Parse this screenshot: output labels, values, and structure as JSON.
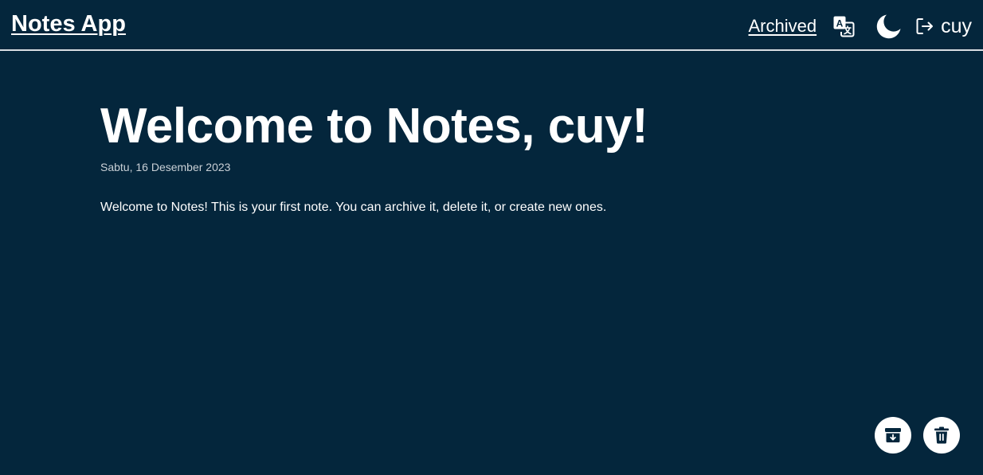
{
  "header": {
    "brand": "Notes App",
    "archived_link": "Archived",
    "user_name": "cuy",
    "icons": {
      "translate": "translate-icon",
      "theme": "moon-icon",
      "logout": "logout-icon"
    }
  },
  "note": {
    "title": "Welcome to Notes, cuy!",
    "date": "Sabtu, 16 Desember 2023",
    "body": "Welcome to Notes! This is your first note. You can archive it, delete it, or create new ones."
  },
  "actions": {
    "archive_icon": "archive-icon",
    "delete_icon": "trash-icon"
  },
  "colors": {
    "background": "#04263c",
    "text": "#ffffff",
    "fab_background": "#ffffff"
  }
}
